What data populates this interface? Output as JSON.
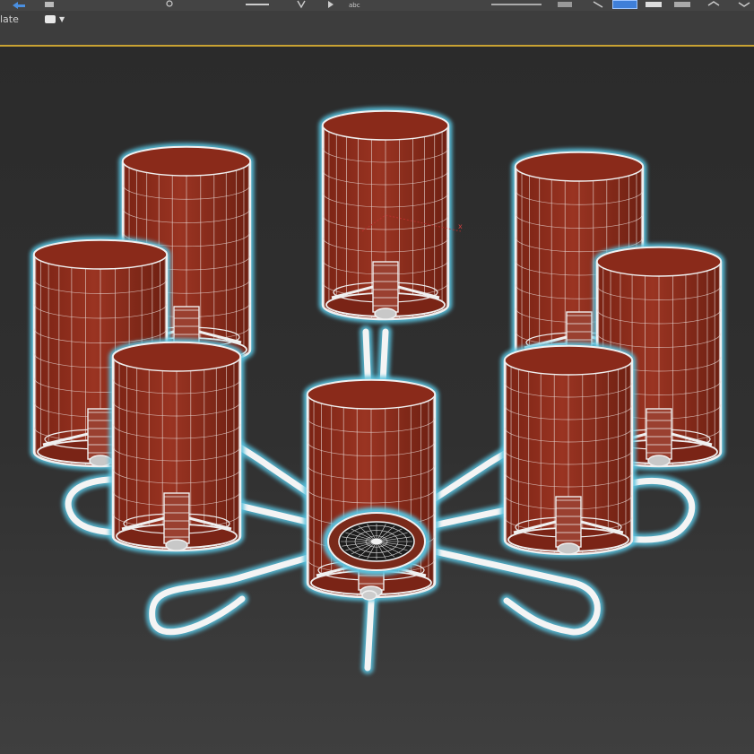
{
  "toolbar": {
    "icons": [
      "undo-icon",
      "redo-icon",
      "link-icon",
      "unlink-icon",
      "bind-icon",
      "select-icon",
      "move-icon",
      "rotate-icon",
      "scale-icon",
      "snap-icon",
      "align-icon",
      "layer-icon",
      "render-icon",
      "viewport-icon"
    ]
  },
  "ribbon": {
    "label": "late",
    "dropdown_icon": "viewport-shading-icon"
  },
  "viewport": {
    "object": "chandelier-wireframe",
    "gizmo_label": "x",
    "colors": {
      "background_top": "#2b2b2b",
      "background_bottom": "#3f3f3f",
      "shade_fill": "#8c2e1e",
      "shade_fill_dark": "#6e2012",
      "wire": "#f0f0f0",
      "selection_glow": "#59c2df",
      "accent": "#3f7fd8"
    }
  }
}
